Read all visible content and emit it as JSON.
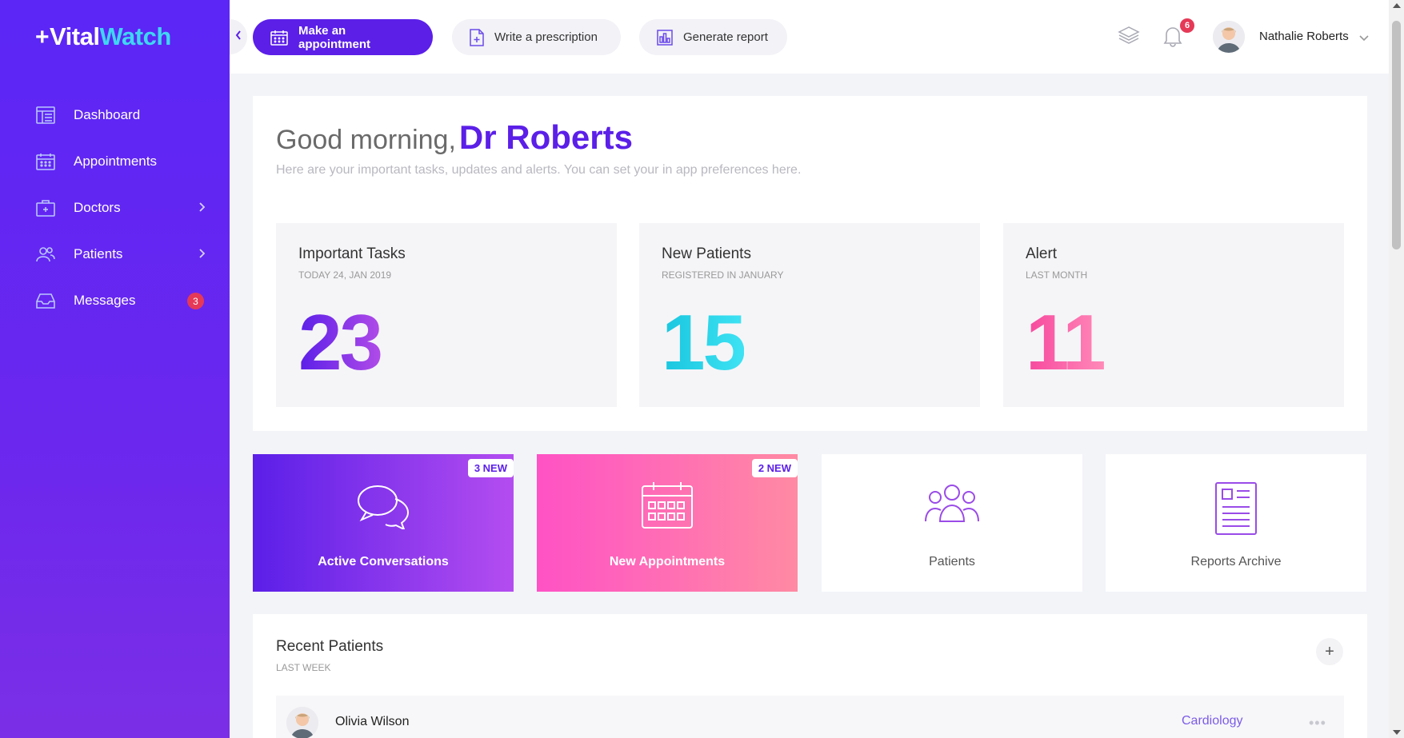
{
  "brand": {
    "prefix": "+",
    "name_part1": "Vital",
    "name_part2": "Watch"
  },
  "sidebar": {
    "items": [
      {
        "label": "Dashboard",
        "icon": "dashboard-icon"
      },
      {
        "label": "Appointments",
        "icon": "calendar-icon"
      },
      {
        "label": "Doctors",
        "icon": "medical-case-icon",
        "has_submenu": true
      },
      {
        "label": "Patients",
        "icon": "users-icon",
        "has_submenu": true
      },
      {
        "label": "Messages",
        "icon": "inbox-icon",
        "badge": "3"
      }
    ]
  },
  "toolbar": {
    "make_appointment": "Make an appointment",
    "write_prescription": "Write a prescription",
    "generate_report": "Generate report",
    "notification_count": "6",
    "user_name": "Nathalie Roberts"
  },
  "welcome": {
    "greeting": "Good morning,",
    "doctor": "Dr Roberts",
    "subtitle": "Here are your important tasks, updates and alerts. You can set your in app preferences here."
  },
  "stats": [
    {
      "title": "Important Tasks",
      "subtitle": "TODAY 24, JAN 2019",
      "value": "23"
    },
    {
      "title": "New Patients",
      "subtitle": "REGISTERED IN JANUARY",
      "value": "15"
    },
    {
      "title": "Alert",
      "subtitle": "LAST MONTH",
      "value": "11"
    }
  ],
  "tiles": [
    {
      "label": "Active Conversations",
      "badge": "3 NEW",
      "icon": "chat-bubbles-icon"
    },
    {
      "label": "New Appointments",
      "badge": "2 NEW",
      "icon": "calendar-icon"
    },
    {
      "label": "Patients",
      "icon": "users-group-icon"
    },
    {
      "label": "Reports Archive",
      "icon": "report-document-icon"
    }
  ],
  "recent": {
    "title": "Recent Patients",
    "subtitle": "LAST WEEK",
    "add_label": "+",
    "rows": [
      {
        "name": "Olivia Wilson",
        "department": "Cardiology",
        "more": "•••"
      }
    ]
  },
  "colors": {
    "primary": "#5b1fe8",
    "cyan": "#3fd6f2",
    "pink": "#ff52c5",
    "badge_red": "#e53957"
  }
}
